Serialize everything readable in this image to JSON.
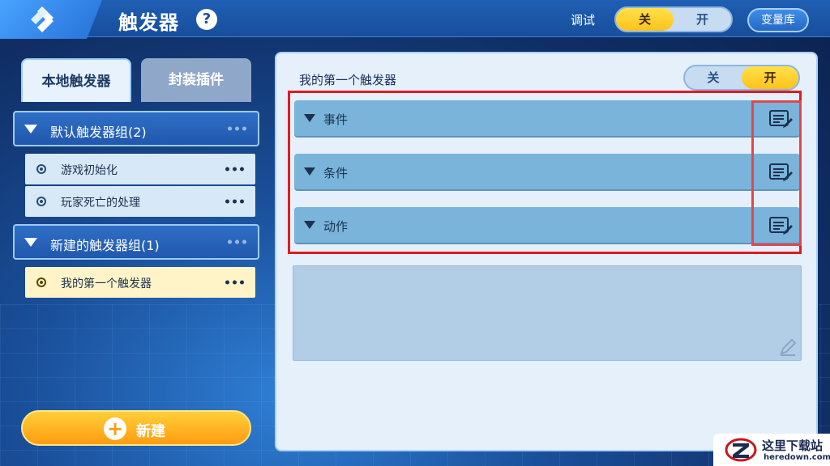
{
  "header": {
    "title": "触发器",
    "help_icon": "?",
    "debug_label": "调试",
    "debug_toggle": {
      "off": "关",
      "on": "开",
      "active": "off"
    },
    "variable_library_label": "变量库"
  },
  "sidebar": {
    "tabs": [
      {
        "label": "本地触发器",
        "active": true
      },
      {
        "label": "封装插件",
        "active": false
      }
    ],
    "groups": [
      {
        "label": "默认触发器组(2)",
        "items": [
          {
            "label": "游戏初始化",
            "selected": false
          },
          {
            "label": "玩家死亡的处理",
            "selected": false
          }
        ]
      },
      {
        "label": "新建的触发器组(1)",
        "items": [
          {
            "label": "我的第一个触发器",
            "selected": true
          }
        ]
      }
    ],
    "new_button_label": "新建"
  },
  "editor": {
    "trigger_name": "我的第一个触发器",
    "enable_toggle": {
      "off": "关",
      "on": "开",
      "active": "on"
    },
    "sections": [
      {
        "label": "事件",
        "icon": "edit-list-icon"
      },
      {
        "label": "条件",
        "icon": "edit-list-icon"
      },
      {
        "label": "动作",
        "icon": "edit-list-icon"
      }
    ],
    "highlight_color": "#e01a22"
  },
  "watermark": {
    "cn": "这里下载站",
    "en": "heredown.com"
  },
  "colors": {
    "accent_yellow": "#ffc21a",
    "primary_blue": "#2058ad",
    "section_blue": "#7ab4da"
  }
}
